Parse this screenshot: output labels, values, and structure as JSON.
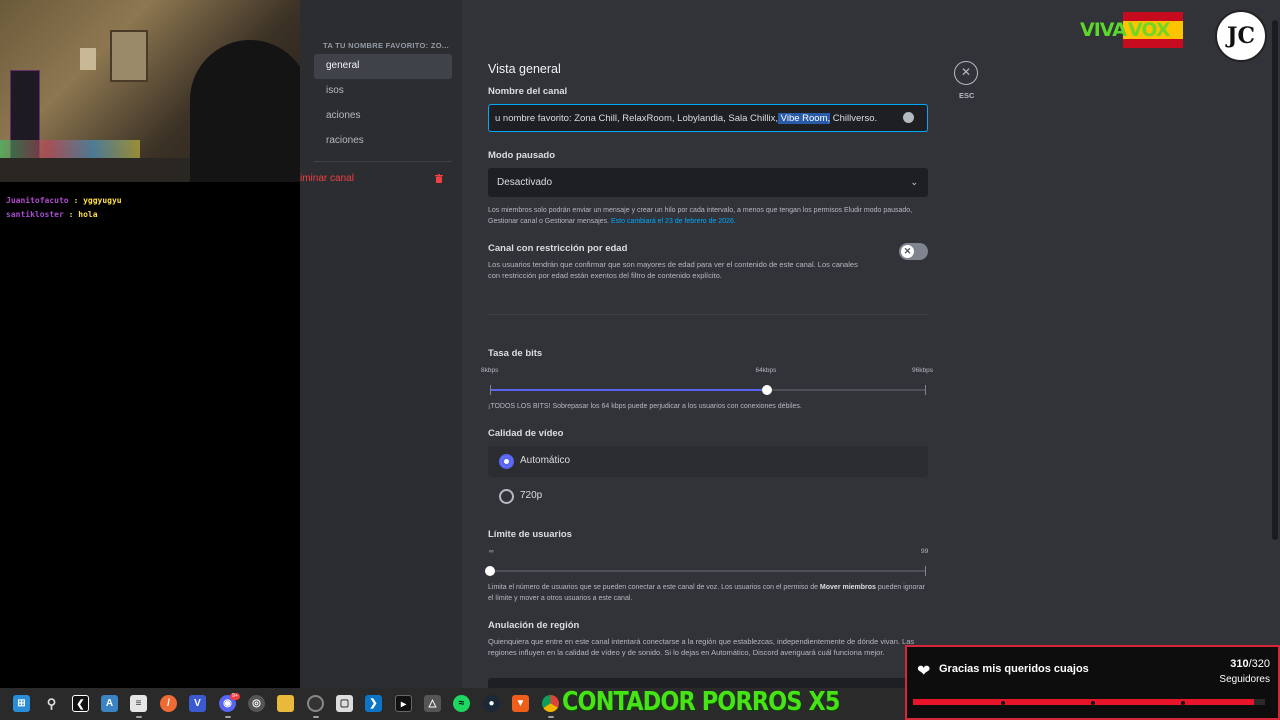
{
  "chat": [
    {
      "user": "Juanitofacuto",
      "message": "yggyugyu"
    },
    {
      "user": "santikloster",
      "message": "hola"
    }
  ],
  "sidebar": {
    "header": "TA TU NOMBRE FAVORITO: ZO...",
    "items": [
      {
        "label": "general",
        "selected": true
      },
      {
        "label": "isos",
        "selected": false
      },
      {
        "label": "aciones",
        "selected": false
      },
      {
        "label": "raciones",
        "selected": false
      }
    ],
    "delete_label": "iminar canal",
    "trash_icon": "trash-icon"
  },
  "main": {
    "title": "Vista general",
    "channel_name": {
      "label": "Nombre del canal",
      "value_plain": "u nombre favorito: Zona Chill, RelaxRoom, Lobylandia, Sala Chillix,",
      "value_selected": " Vibe Room,",
      "value_rest": " Chillverso."
    },
    "slowmode": {
      "label": "Modo pausado",
      "value": "Desactivado",
      "note_text": "Los miembros solo podrán enviar un mensaje y crear un hilo por cada intervalo, a menos que tengan los permisos Eludir modo pausado, Gestionar canal o Gestionar mensajes.",
      "note_link": "Esto cambiará el 23 de febrero de 2026."
    },
    "age_restricted": {
      "label": "Canal con restricción por edad",
      "description": "Los usuarios tendrán que confirmar que son mayores de edad para ver el contenido de este canal. Los canales con restricción por edad están exentos del filtro de contenido explícito.",
      "enabled": false
    },
    "bitrate": {
      "label": "Tasa de bits",
      "ticks": [
        "8kbps",
        "64kbps",
        "96kbps"
      ],
      "value_kbps": 64,
      "min_kbps": 8,
      "max_kbps": 96,
      "note": "¡TODOS LOS BITS! Sobrepasar los 64 kbps puede perjudicar a los usuarios con conexiones débiles."
    },
    "video_quality": {
      "label": "Calidad de vídeo",
      "options": [
        {
          "label": "Automático",
          "selected": true
        },
        {
          "label": "720p",
          "selected": false
        }
      ]
    },
    "user_limit": {
      "label": "Límite de usuarios",
      "ticks": [
        "∞",
        "99"
      ],
      "value": 0,
      "note_a": "Limita el número de usuarios que se pueden conectar a este canal de voz. Los usuarios con el permiso de ",
      "note_b": "Mover miembros",
      "note_c": " pueden ignorar el límite y mover a otros usuarios a este canal."
    },
    "region": {
      "label": "Anulación de región",
      "description": "Quienquiera que entre en este canal intentará conectarse a la región que establezcas, independientemente de dónde vivan. Las regiones influyen en la calidad de vídeo y de sonido. Si lo dejas en Automático, Discord averiguará cuál funciona mejor."
    },
    "close_label": "ESC"
  },
  "overlays": {
    "viva_a": "VIVA",
    "viva_b": "VOX",
    "logo": "JC",
    "follower_message": "Gracias mis queridos cuajos",
    "follower_current": "310",
    "follower_goal": "/320",
    "follower_unit": "Seguidores",
    "follower_progress": 0.969,
    "counter_banner": "CONTADOR PORROS X5"
  },
  "taskbar": {
    "icons": [
      "windows-icon",
      "search-icon",
      "capcut-icon",
      "app-icon",
      "notes-icon",
      "brave-icon",
      "vpn-icon",
      "discord-icon",
      "steam-hub-icon",
      "obs-icon",
      "files-icon",
      "chrome-dev-icon",
      "box-icon",
      "vscode-icon",
      "terminal-icon",
      "unity-icon",
      "spotify-icon",
      "steam-icon",
      "brave-lion-icon",
      "chrome-icon"
    ],
    "discord_badge": "9+"
  },
  "colors": {
    "accent": "#5865f2",
    "link": "#00a8fc",
    "danger": "#f23f43",
    "banner_green": "#46e316"
  }
}
